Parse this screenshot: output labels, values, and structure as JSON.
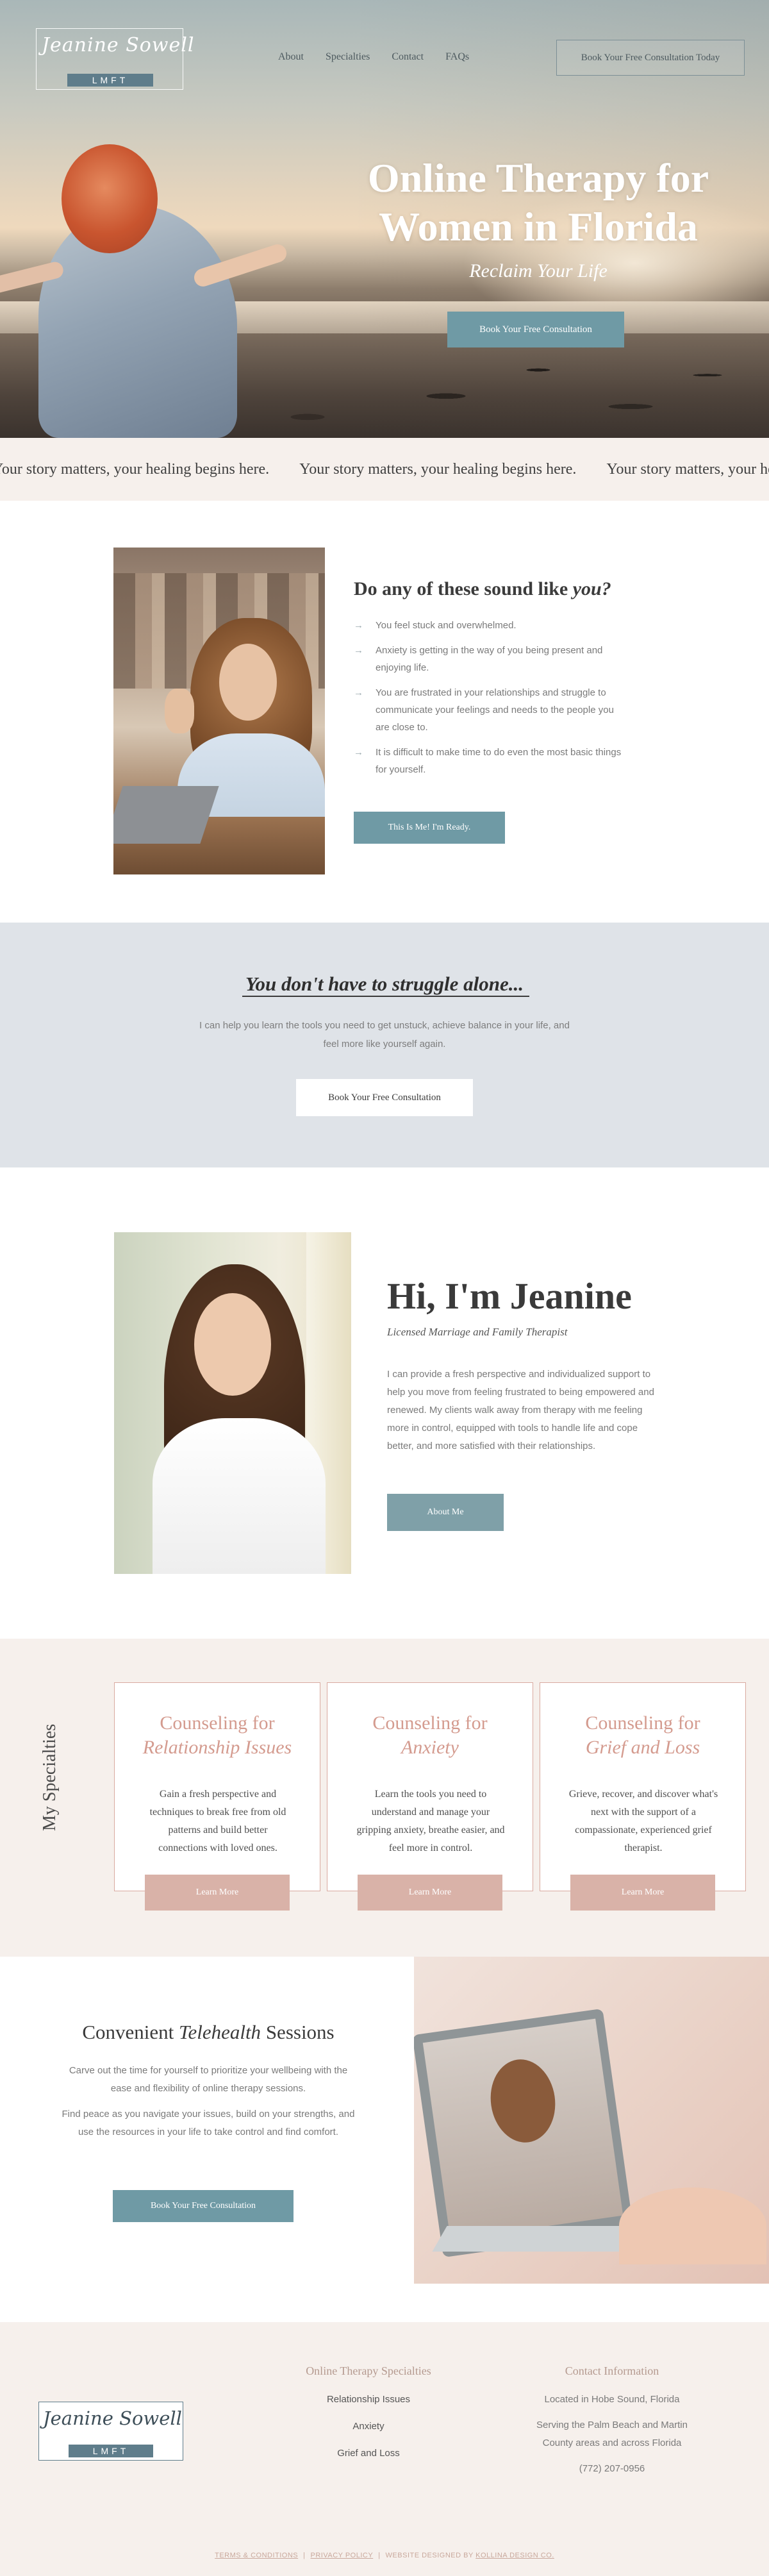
{
  "header": {
    "logo_script": "Jeanine Sowell",
    "logo_tag": "LMFT",
    "nav": [
      "About",
      "Specialties",
      "Contact",
      "FAQs"
    ],
    "cta": "Book Your Free Consultation Today"
  },
  "hero": {
    "title": "Online Therapy for Women in Florida",
    "subtitle": "Reclaim Your Life",
    "button": "Book Your Free Consultation"
  },
  "marquee": {
    "items": [
      "Your story matters, your healing begins here.",
      "Your story matters, your healing begins here.",
      "Your story matters, your healing begins here."
    ]
  },
  "sound_like": {
    "title_main": "Do any of these sound like ",
    "title_em": "you?",
    "items": [
      "You feel stuck and overwhelmed.",
      "Anxiety is getting in the way of you being present and enjoying life.",
      "You are frustrated in your relationships and struggle to communicate your feelings and needs to the people you are close to.",
      "It is difficult to make time to do even the most basic things for yourself."
    ],
    "button": "This Is Me! I'm Ready."
  },
  "struggle": {
    "title": "You don't have to struggle alone...",
    "text": "I can help you learn the tools you need to get unstuck, achieve balance in your life, and feel more like yourself again.",
    "button": "Book Your Free Consultation"
  },
  "about": {
    "title": "Hi, I'm Jeanine",
    "subtitle": "Licensed Marriage and Family Therapist",
    "text": "I can provide a fresh perspective and individualized support to help you move from feeling frustrated to being empowered and renewed. My clients walk away from therapy with me feeling more in control, equipped with tools to handle life and cope better, and more satisfied with their relationships.",
    "button": "About Me"
  },
  "specialties": {
    "heading": "My Specialties",
    "cards": [
      {
        "title_top": "Counseling for",
        "title_em": "Relationship Issues",
        "text": "Gain a fresh perspective and techniques to break free from old patterns and build better connections with loved ones.",
        "button": "Learn More"
      },
      {
        "title_top": "Counseling for",
        "title_em": "Anxiety",
        "text": "Learn the tools you need to understand and manage your gripping anxiety, breathe easier, and feel more in control.",
        "button": "Learn More"
      },
      {
        "title_top": "Counseling for",
        "title_em": "Grief and Loss",
        "text": "Grieve, recover, and discover what's next with the support of a compassionate, experienced grief therapist.",
        "button": "Learn More"
      }
    ]
  },
  "telehealth": {
    "title_pre": "Convenient ",
    "title_em": "Telehealth",
    "title_post": " Sessions",
    "p1": "Carve out the time for yourself to prioritize your wellbeing with the ease and flexibility of online therapy sessions.",
    "p2": "Find peace as you navigate your issues, build on your strengths, and use the resources in your life to take control and find comfort.",
    "button": "Book Your Free Consultation"
  },
  "footer": {
    "logo_script": "Jeanine Sowell",
    "logo_tag": "LMFT",
    "col1_title": "Online Therapy Specialties",
    "col1_items": [
      "Relationship Issues",
      "Anxiety",
      "Grief and Loss"
    ],
    "col2_title": "Contact Information",
    "col2_items": [
      "Located in Hobe Sound, Florida",
      "Serving the Palm Beach and Martin County areas and across Florida",
      "(772) 207-0956"
    ],
    "legal": {
      "terms": "TERMS & CONDITIONS",
      "privacy": "PRIVACY POLICY",
      "credit_pre": "WEBSITE DESIGNED BY ",
      "credit_link": "KOLLINA DESIGN CO."
    }
  },
  "colors": {
    "accent_teal": "#6f9aa5",
    "rose": "#d49b8f",
    "blush_bg": "#f6f0ec",
    "mist_bg": "#dfe3e8"
  }
}
